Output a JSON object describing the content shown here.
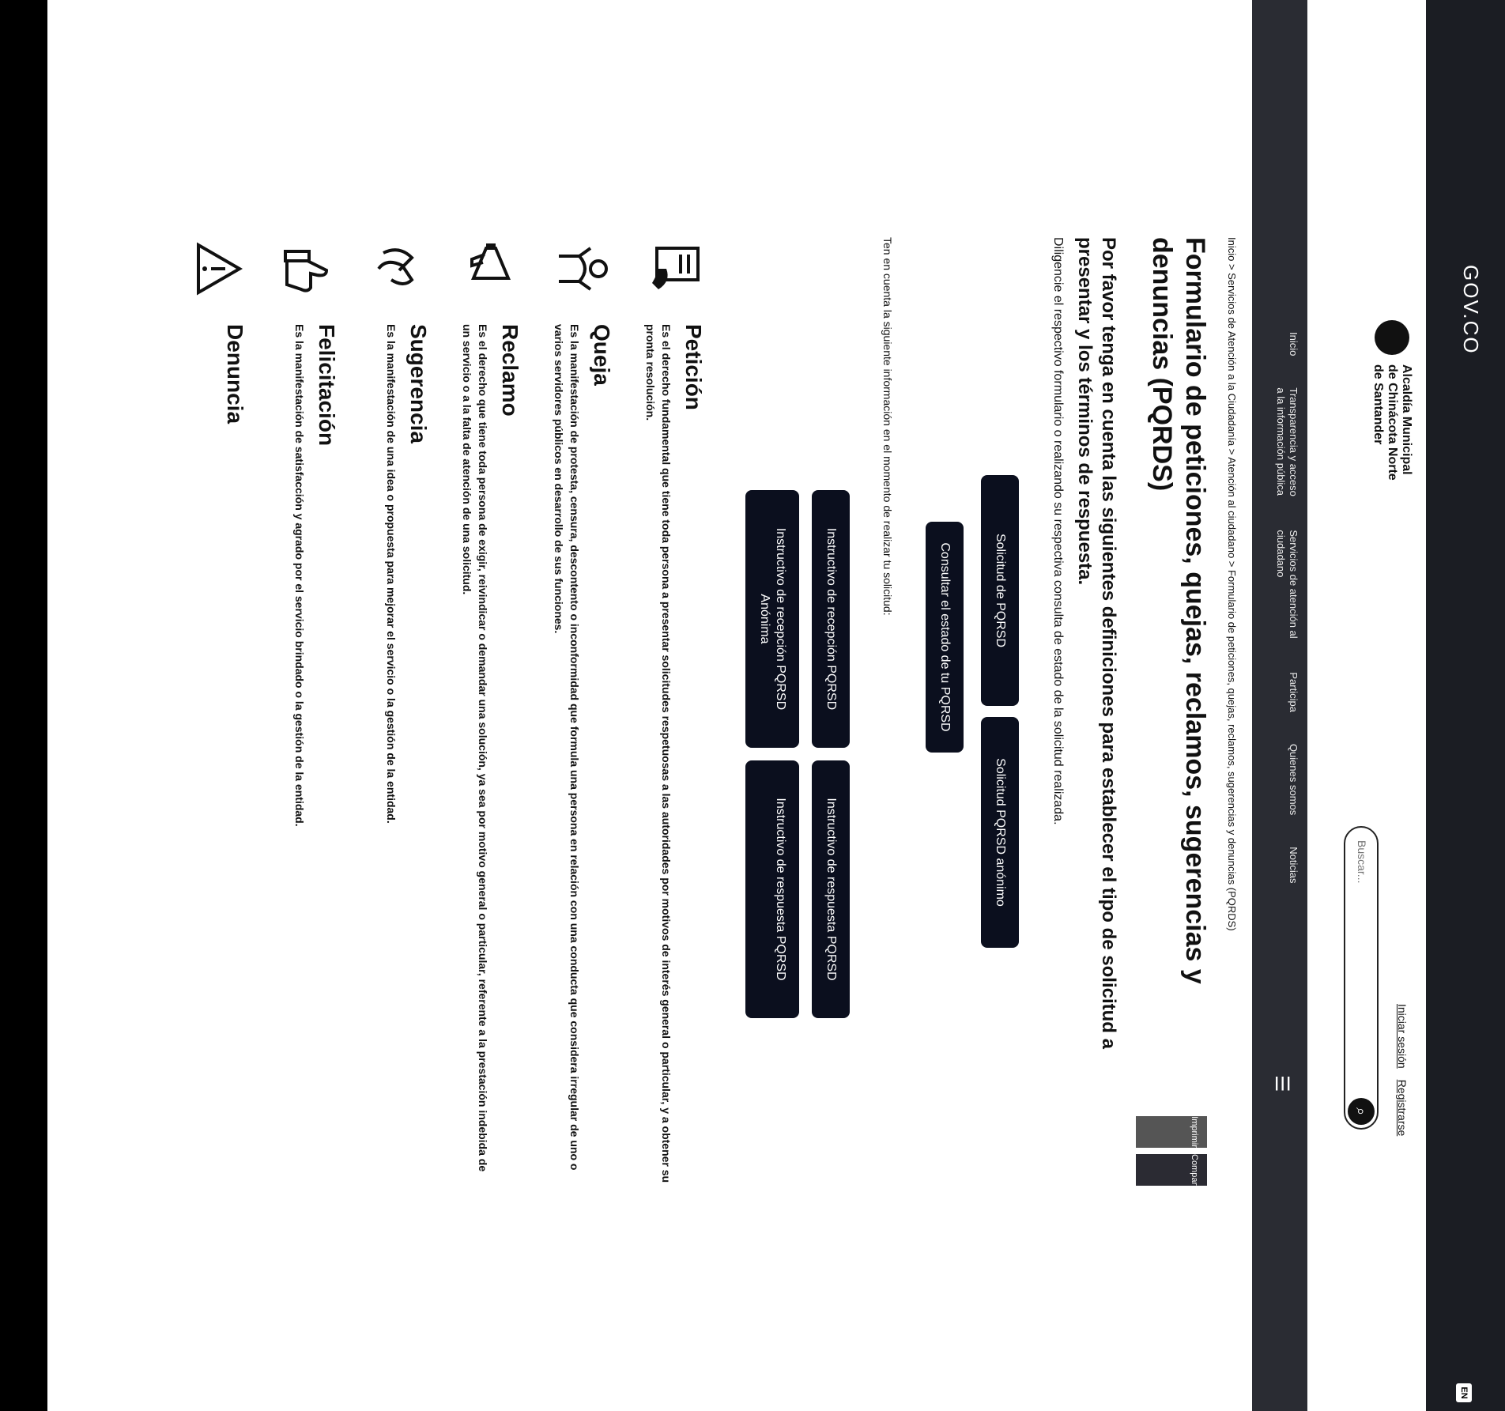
{
  "topbar": {
    "logo": "GOV.CO",
    "lang": "EN"
  },
  "header": {
    "brand": "Alcaldía Municipal de Chinácota Norte de Santander",
    "search_placeholder": "Buscar...",
    "login": "Iniciar sesión",
    "register": "Registrarse"
  },
  "nav": {
    "items": [
      "Inicio",
      "Transparencia y acceso a la información pública",
      "Servicios de atención al ciudadano",
      "Participa",
      "Quienes somos",
      "Noticias"
    ]
  },
  "breadcrumb": "Inicio > Servicios de Atención a la Ciudadanía > Atención al ciudadano > Formulario de peticiones, quejas, reclamos, sugerencias y denuncias (PQRDS)",
  "title": "Formulario de peticiones, quejas, reclamos, sugerencias y denuncias (PQRDS)",
  "toolbar": {
    "print": "Imprimir",
    "share": "Compartir"
  },
  "lead": "Por favor tenga en cuenta las siguientes definiciones para establecer el tipo de solicitud a presentar y los términos de respuesta.",
  "lead2": "Diligencie el respectivo formulario o realizando su respectiva consulta de estado de la solicitud realizada.",
  "buttons": {
    "pqrsd": "Solicitud de PQRSD",
    "anon": "Solicitud PQRSD anónimo",
    "consult_note": "Ten en cuenta la siguiente información en el momento de realizar tu solicitud:",
    "consult": "Consultar el estado de tu PQRSD",
    "instr_pqrsd": "Instructivo de recepción PQRSD",
    "instr_anon": "Instructivo de recepción PQRSD Anónima",
    "instr_answer": "Instructivo de respuesta PQRSD"
  },
  "definitions": [
    {
      "icon": "document-hand-icon",
      "title": "Petición",
      "text": "Es el derecho fundamental que tiene toda persona a presentar solicitudes respetuosas a las autoridades por motivos de interés general o particular, y a obtener su pronta resolución."
    },
    {
      "icon": "protest-icon",
      "title": "Queja",
      "text": "Es la manifestación de protesta, censura, descontento o inconformidad que formula una persona en relación con una conducta que considera irregular de uno o varios servidores públicos en desarrollo de sus funciones."
    },
    {
      "icon": "megaphone-icon",
      "title": "Reclamo",
      "text": "Es el derecho que tiene toda persona de exigir, reivindicar o demandar una solución, ya sea por motivo general o particular, referente a la prestación indebida de un servicio o a la falta de atención de una solicitud."
    },
    {
      "icon": "clapping-hands-icon",
      "title": "Sugerencia",
      "text": "Es la manifestación de una idea o propuesta para mejorar el servicio o la gestión de la entidad."
    },
    {
      "icon": "thumbs-up-icon",
      "title": "Felicitación",
      "text": "Es la manifestación de satisfacción y agrado por el servicio brindado o la gestión de la entidad."
    },
    {
      "icon": "warning-hand-icon",
      "title": "Denuncia",
      "text": ""
    }
  ]
}
